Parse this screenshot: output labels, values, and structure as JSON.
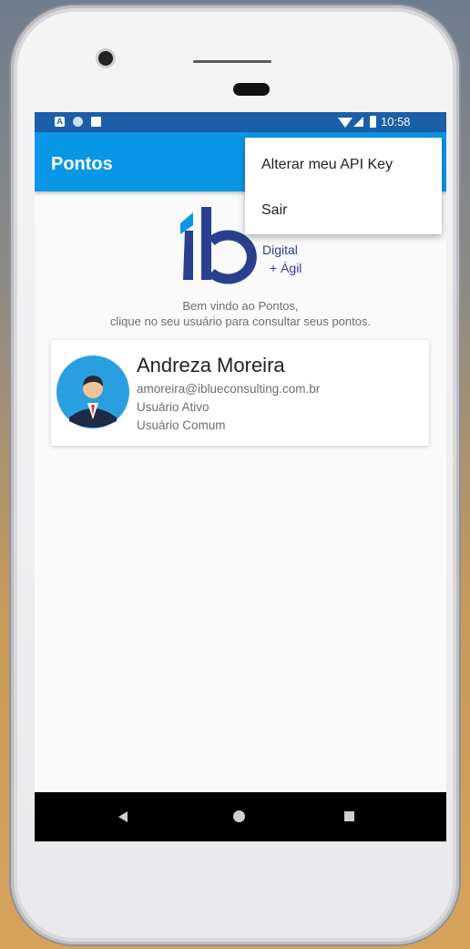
{
  "status_bar": {
    "time": "10:58",
    "icons": [
      "notification-a-icon",
      "circle-notification-icon",
      "sd-card-icon",
      "wifi-icon",
      "cell-signal-icon",
      "battery-icon"
    ]
  },
  "app_bar": {
    "title": "Pontos",
    "background": "#0a96e6"
  },
  "overflow_menu": {
    "items": [
      {
        "label": "Alterar meu API Key"
      },
      {
        "label": "Sair"
      }
    ]
  },
  "logo": {
    "mark": "ib",
    "tagline_1": "Digital",
    "tagline_2": "+ Ágil"
  },
  "welcome": {
    "line1": "Bem vindo ao Pontos,",
    "line2": "clique no seu usuário para consultar seus pontos."
  },
  "user_card": {
    "name": "Andreza Moreira",
    "email": "amoreira@iblueconsulting.com.br",
    "status": "Usuário Ativo",
    "type": "Usuário Comum"
  },
  "nav_bar": {
    "icons": [
      "back-icon",
      "home-icon",
      "recents-icon"
    ]
  },
  "colors": {
    "status_bar": "#1a5fa8",
    "app_bar": "#0a96e6",
    "logo_blue": "#2a3f8f"
  }
}
